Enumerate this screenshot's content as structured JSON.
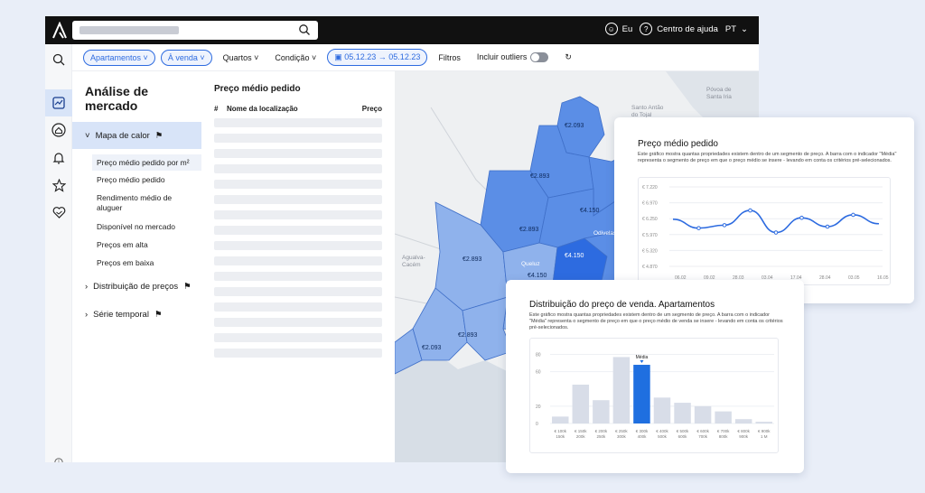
{
  "topbar": {
    "user_label": "Eu",
    "help_label": "Centro de ajuda",
    "lang_label": "PT"
  },
  "filters": {
    "property_type": "Apartamentos",
    "operation": "À venda",
    "rooms": "Quartos",
    "condition": "Condição",
    "date_range": "05.12.23 → 05.12.23",
    "filters_label": "Filtros",
    "outliers_label": "Incluir outliers"
  },
  "sidenav": {
    "title": "Análise de mercado",
    "section_heat": "Mapa de calor",
    "items": [
      "Preço médio pedido por m²",
      "Preço médio pedido",
      "Rendimento médio de aluguer",
      "Disponível no mercado",
      "Preços em alta",
      "Preços em baixa"
    ],
    "group_distribution": "Distribuição de preços",
    "group_timeseries": "Série temporal"
  },
  "list": {
    "title": "Preço médio pedido",
    "col_hash": "#",
    "col_name": "Nome da localização",
    "col_price": "Preço"
  },
  "map": {
    "places": [
      "Póvoa de Santa Iria",
      "Santo Antão do Tojal",
      "Odivelas",
      "Agualva-Cacém",
      "Queluz"
    ],
    "region_labels": [
      "€2.093",
      "€2.893",
      "€4.150",
      "€2.893",
      "€2.893",
      "€4.150",
      "€2.893",
      "€4.150",
      "€2.093",
      "€4.15"
    ],
    "region_colors": {
      "light": "#8fb2ec",
      "mid": "#5b8ee6",
      "dark": "#2d6be0"
    }
  },
  "card_line": {
    "title": "Preço médio pedido",
    "desc": "Este gráfico mostra quantas propriedades existem dentro de um segmento de preço. A barra com o indicador \"Média\" representa o segmento de preço em que o preço médio se insere - levando em conta os critérios pré-selecionados.",
    "color": "#2d6be0"
  },
  "card_bar": {
    "title": "Distribuição do preço de venda. Apartamentos",
    "desc": "Este gráfico mostra quantas propriedades existem dentro de um segmento de preço. A barra com o indicador \"Média\" representa o segmento de preço em que o preço médio de venda se insere - levando em conta os critérios pré-selecionados.",
    "mean_label": "Média",
    "highlight_color": "#1f6fe0",
    "bar_color": "#d8dde8"
  },
  "chart_data": [
    {
      "type": "line",
      "title": "Preço médio pedido",
      "yticks": [
        "€ 7.220",
        "€ 6.970",
        "€ 6.250",
        "€ 5.970",
        "€ 5.320",
        "€ 4.870"
      ],
      "x": [
        "06.02",
        "09.02",
        "28.03",
        "03.04",
        "17.04",
        "28.04",
        "03.05",
        "16.05"
      ],
      "values": [
        6.2,
        5.9,
        6.0,
        6.5,
        5.75,
        6.25,
        5.95,
        6.35,
        6.05
      ],
      "ylim": [
        4.6,
        7.3
      ],
      "grid": true
    },
    {
      "type": "bar",
      "title": "Distribuição do preço de venda. Apartamentos",
      "categories": [
        "€ 100k 150k",
        "€ 150k 200k",
        "€ 200k 250k",
        "€ 250k 300k",
        "€ 300k 400k",
        "€ 400k 500k",
        "€ 500k 600k",
        "€ 600k 700k",
        "€ 700k 800k",
        "€ 800k 900k",
        "€ 900k 1 M"
      ],
      "values": [
        8,
        45,
        27,
        77,
        68,
        30,
        24,
        20,
        14,
        5,
        2
      ],
      "highlight_index": 4,
      "yticks": [
        "80",
        "60",
        "20",
        "0"
      ],
      "ylim": [
        0,
        90
      ],
      "grid": true
    }
  ]
}
